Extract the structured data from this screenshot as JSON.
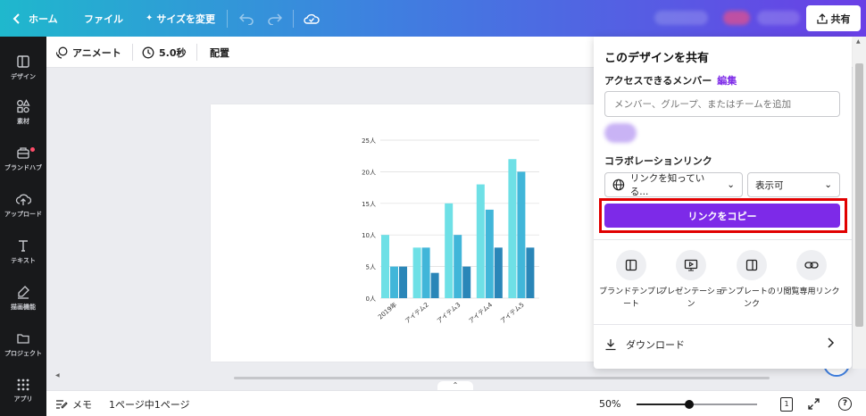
{
  "topbar": {
    "home_label": "ホーム",
    "file_label": "ファイル",
    "resize_label": "サイズを変更",
    "share_label": "共有"
  },
  "leftnav": {
    "items": [
      {
        "label": "デザイン",
        "icon": "layout-icon"
      },
      {
        "label": "素材",
        "icon": "shapes-icon"
      },
      {
        "label": "ブランドハブ",
        "icon": "brand-hub-icon"
      },
      {
        "label": "アップロード",
        "icon": "upload-icon"
      },
      {
        "label": "テキスト",
        "icon": "text-icon"
      },
      {
        "label": "描画機能",
        "icon": "draw-icon"
      },
      {
        "label": "プロジェクト",
        "icon": "folder-icon"
      },
      {
        "label": "アプリ",
        "icon": "apps-icon"
      }
    ]
  },
  "editor_toolbar": {
    "animate_label": "アニメート",
    "duration_label": "5.0秒",
    "position_label": "配置"
  },
  "chart_data": {
    "type": "bar",
    "categories": [
      "2019年",
      "アイテム2",
      "アイテム3",
      "アイテム4",
      "アイテム5"
    ],
    "series": [
      {
        "values": [
          10,
          8,
          15,
          18,
          22
        ],
        "color": "#6ee0e6"
      },
      {
        "values": [
          5,
          8,
          10,
          14,
          20
        ],
        "color": "#41b6d9"
      },
      {
        "values": [
          5,
          4,
          5,
          8,
          8
        ],
        "color": "#2a86b8"
      }
    ],
    "yticks": [
      "0人",
      "5人",
      "10人",
      "15人",
      "20人",
      "25人"
    ],
    "ylim": [
      0,
      25
    ],
    "grid": true
  },
  "share_panel": {
    "title": "このデザインを共有",
    "access_label": "アクセスできるメンバー",
    "edit_link": "編集",
    "people_placeholder": "メンバー、グループ、またはチームを追加",
    "collab_label": "コラボレーションリンク",
    "link_scope": "リンクを知っている...",
    "permission": "表示可",
    "copy_link": "リンクをコピー",
    "options": [
      {
        "label": "ブランドテンプレート",
        "icon": "brand-template-icon"
      },
      {
        "label": "プレゼンテーション",
        "icon": "presentation-icon"
      },
      {
        "label": "テンプレートのリンク",
        "icon": "template-link-icon"
      },
      {
        "label": "閲覧専用リンク",
        "icon": "link-icon"
      }
    ],
    "download_label": "ダウンロード"
  },
  "bottombar": {
    "notes_label": "メモ",
    "page_info": "1ページ中1ページ",
    "zoom": "50%",
    "zoom_fraction": 0.44,
    "page_count": "1",
    "help": "?"
  },
  "colors": {
    "accent": "#7d2ae8",
    "highlight": "#e10000"
  }
}
